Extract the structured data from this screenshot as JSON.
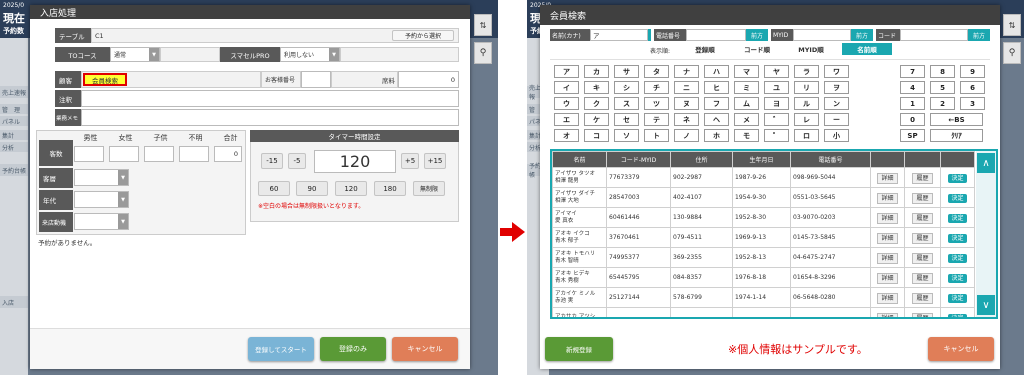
{
  "left": {
    "bg": {
      "date": "2025/0",
      "title": "現在",
      "sub": "予約数",
      "refresh": "⇅",
      "menu_items": [
        "売上速報",
        "管　理",
        "パネル",
        "集計",
        "分析",
        "予約台帳",
        "入店"
      ]
    },
    "title": "入店処理",
    "table_label": "テーブル",
    "table_value": "C1",
    "reserve_select": "予約から選択",
    "tocourse_label": "TOコース",
    "tocourse_value": "通常",
    "smasale_label": "スマセルPRO",
    "smasale_value": "利用しない",
    "customer_label": "顧客",
    "member_search": "会員検索",
    "customer_no_label": "お客様番号",
    "fee_label": "席料",
    "fee_value": "0",
    "note_label": "注釈",
    "memo_label": "業務メモ",
    "count_headers": [
      "男性",
      "女性",
      "子供",
      "不明",
      "合計"
    ],
    "count_label": "客数",
    "total_value": "0",
    "segment_label": "客層",
    "age_label": "年代",
    "motive_label": "来店動機",
    "timer_title": "タイマー時間設定",
    "timer_value": "120",
    "timer_buttons": [
      "-15",
      "-5",
      "+5",
      "+15"
    ],
    "timer_presets": [
      "60",
      "90",
      "120",
      "180",
      "無制限"
    ],
    "timer_note": "※空白の場合は無制限扱いとなります。",
    "no_reservation": "予約がありません。",
    "btn_start": "登録してスタート",
    "btn_register": "登録のみ",
    "btn_cancel": "キャンセル"
  },
  "right": {
    "title": "会員検索",
    "name_label": "名前(カナ)",
    "name_value": "ア",
    "phone_label": "電話番号",
    "myid_label": "MYID",
    "code_label": "コード",
    "forward": "前方",
    "sort_label": "表示順:",
    "sort_options": [
      "登録順",
      "コード順",
      "MYID順",
      "名前順"
    ],
    "kana_rows": [
      [
        "ア",
        "カ",
        "サ",
        "タ",
        "ナ",
        "ハ",
        "マ",
        "ヤ",
        "ラ",
        "ワ"
      ],
      [
        "イ",
        "キ",
        "シ",
        "チ",
        "ニ",
        "ヒ",
        "ミ",
        "ユ",
        "リ",
        "ヲ"
      ],
      [
        "ウ",
        "ク",
        "ス",
        "ツ",
        "ヌ",
        "フ",
        "ム",
        "ヨ",
        "ル",
        "ン"
      ],
      [
        "エ",
        "ケ",
        "セ",
        "テ",
        "ネ",
        "ヘ",
        "メ",
        "゛",
        "レ",
        "ー"
      ],
      [
        "オ",
        "コ",
        "ソ",
        "ト",
        "ノ",
        "ホ",
        "モ",
        "゜",
        "ロ",
        "小"
      ]
    ],
    "num_rows": [
      [
        "7",
        "8",
        "9"
      ],
      [
        "4",
        "5",
        "6"
      ],
      [
        "1",
        "2",
        "3"
      ],
      [
        "0",
        "←BS"
      ],
      [
        "SP",
        "ｸﾘｱ"
      ]
    ],
    "headers": [
      "名前",
      "コード-MYID",
      "住所",
      "生年月日",
      "電話番号"
    ],
    "rows": [
      {
        "kana": "アイザワ タツオ",
        "name": "相澤 龍男",
        "code": "77673379",
        "zip": "902-2987",
        "birth": "1987-9-26",
        "phone": "098-969-5044"
      },
      {
        "kana": "アイザワ ダイチ",
        "name": "相澤 大地",
        "code": "28547003",
        "zip": "402-4107",
        "birth": "1954-9-30",
        "phone": "0551-03-5645"
      },
      {
        "kana": "アイマイ",
        "name": "愛 真衣",
        "code": "60461446",
        "zip": "130-9884",
        "birth": "1952-8-30",
        "phone": "03-9070-0203"
      },
      {
        "kana": "アオキ イクコ",
        "name": "青木 郁子",
        "code": "37670461",
        "zip": "079-4511",
        "birth": "1969-9-13",
        "phone": "0145-73-5845"
      },
      {
        "kana": "アオキ トモハリ",
        "name": "青木 智晴",
        "code": "74995377",
        "zip": "369-2355",
        "birth": "1952-8-13",
        "phone": "04-6475-2747"
      },
      {
        "kana": "アオキ ヒデキ",
        "name": "青木 秀樹",
        "code": "65445795",
        "zip": "084-8357",
        "birth": "1976-8-18",
        "phone": "01654-8-3296"
      },
      {
        "kana": "アカイケ ミノル",
        "name": "赤池 実",
        "code": "25127144",
        "zip": "578-6799",
        "birth": "1974-1-14",
        "phone": "06-5648-0280"
      },
      {
        "kana": "アカサカ アツシ",
        "name": "",
        "code": "",
        "zip": "",
        "birth": "",
        "phone": ""
      }
    ],
    "detail": "詳細",
    "history": "履歴",
    "decide": "決定",
    "btn_new": "新規登録",
    "notice": "※個人情報はサンプルです。",
    "btn_cancel": "キャンセル"
  }
}
